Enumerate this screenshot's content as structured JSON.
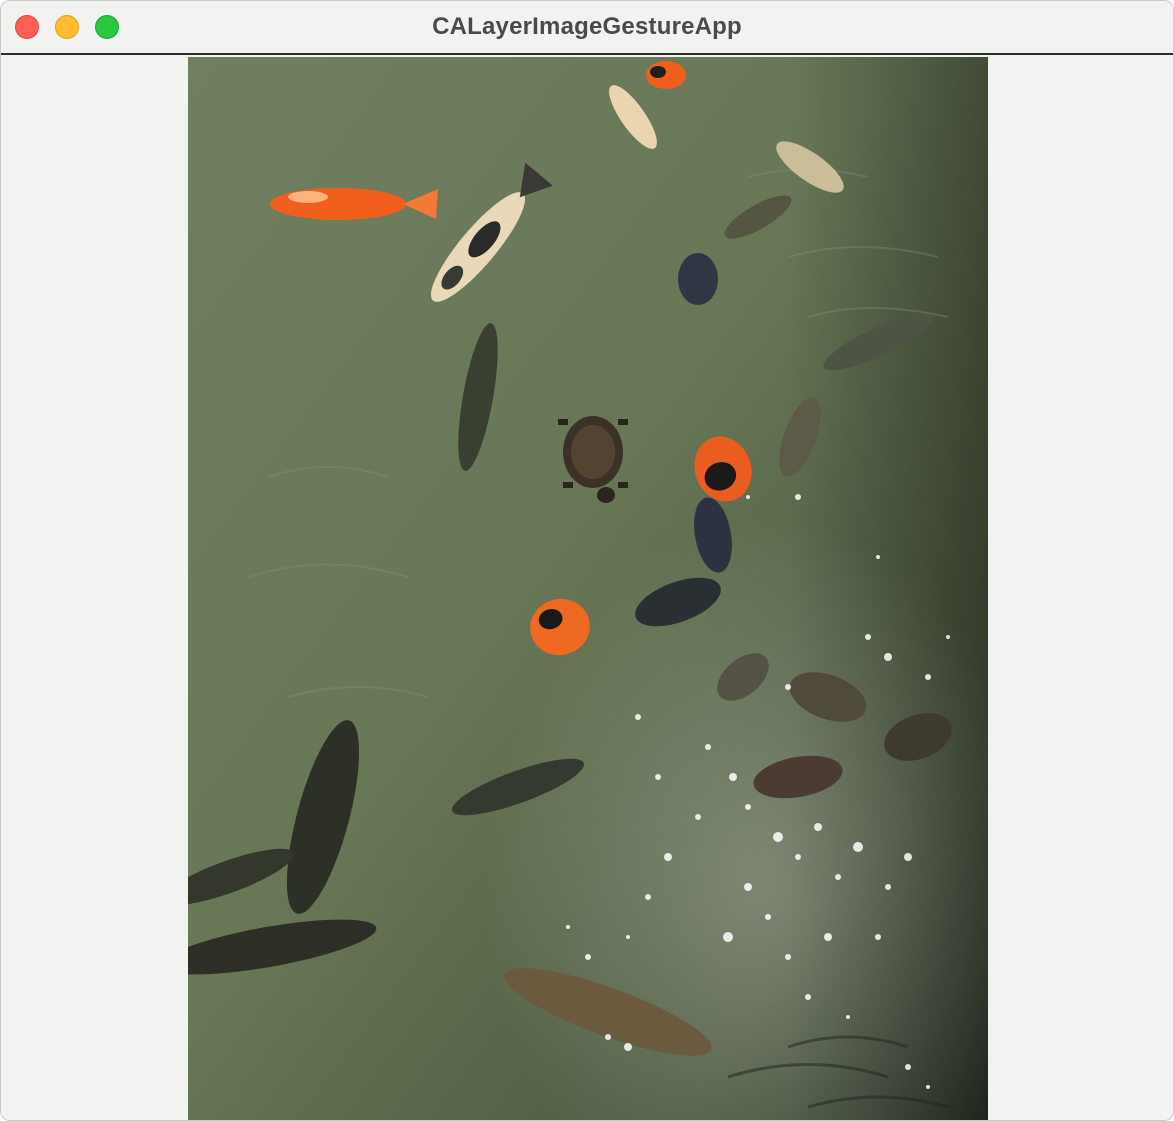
{
  "window": {
    "title": "CALayerImageGestureApp"
  },
  "photo": {
    "subject": "koi-pond-with-turtle"
  },
  "colors": {
    "titlebar_bg": "#f2f2f0",
    "close": "#fe5f57",
    "minimize": "#febc2e",
    "maximize": "#28c840",
    "water": "#6d7b5c"
  }
}
